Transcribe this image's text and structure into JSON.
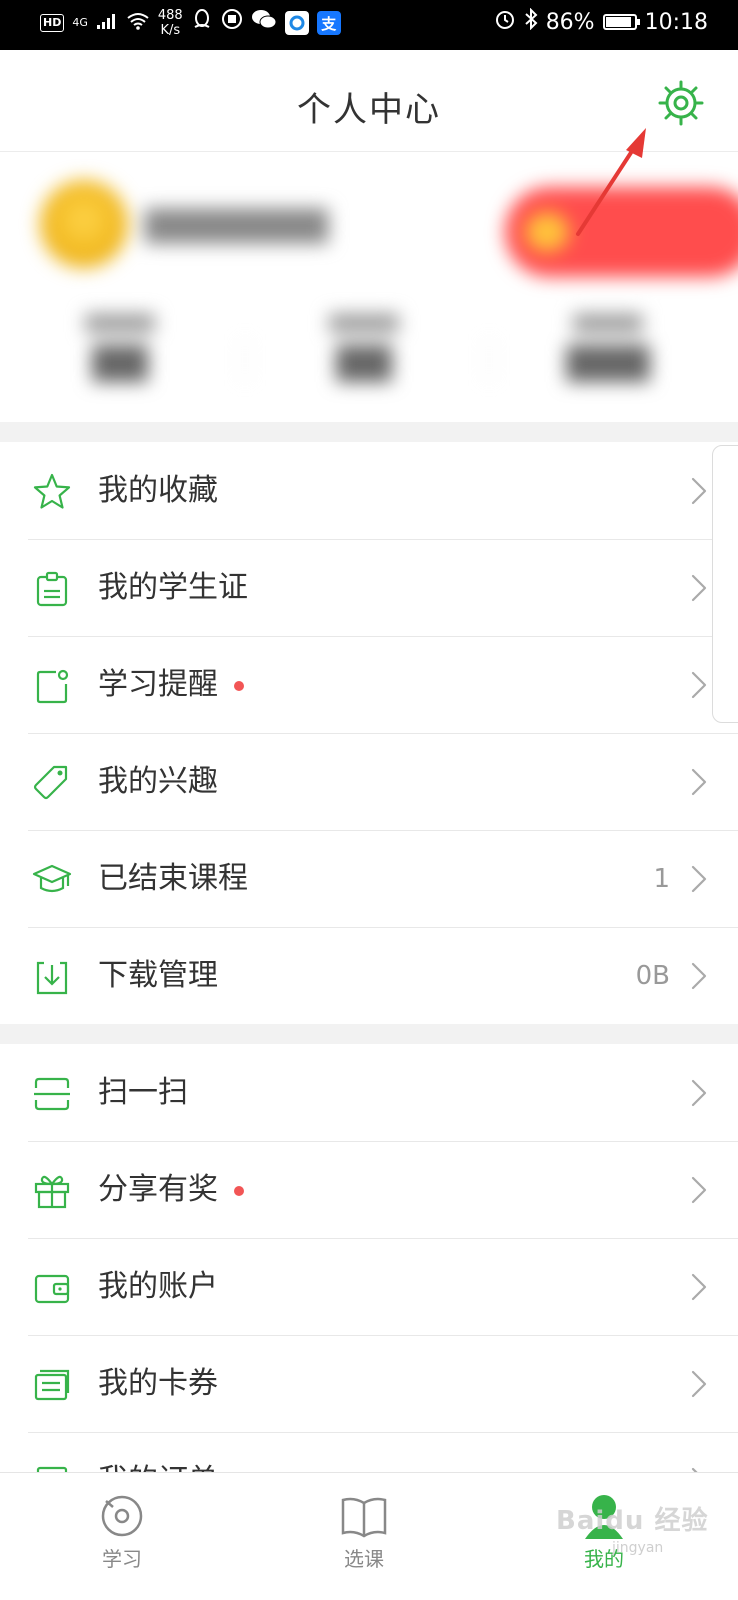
{
  "status_bar": {
    "hd": "HD",
    "network": "4G",
    "speed_value": "488",
    "speed_unit": "K/s",
    "app_icons": [
      "qq-icon",
      "vpn-icon",
      "wechat-icon",
      "browser-icon",
      "alipay-icon"
    ],
    "alipay_glyph": "支",
    "battery_percent": "86%",
    "battery_level": 0.86,
    "time": "10:18"
  },
  "header": {
    "title": "个人中心",
    "settings_icon": "gear-icon"
  },
  "colors": {
    "accent": "#37b34a",
    "dot": "#f25555",
    "annotation": "#e53935"
  },
  "menu_group_1": [
    {
      "label": "我的收藏",
      "icon": "star-icon",
      "dot": false,
      "value": ""
    },
    {
      "label": "我的学生证",
      "icon": "student-card-icon",
      "dot": false,
      "value": ""
    },
    {
      "label": "学习提醒",
      "icon": "reminder-icon",
      "dot": true,
      "value": ""
    },
    {
      "label": "我的兴趣",
      "icon": "tag-icon",
      "dot": false,
      "value": ""
    },
    {
      "label": "已结束课程",
      "icon": "graduation-cap-icon",
      "dot": false,
      "value": "1"
    },
    {
      "label": "下载管理",
      "icon": "download-icon",
      "dot": false,
      "value": "0B"
    }
  ],
  "menu_group_2": [
    {
      "label": "扫一扫",
      "icon": "scan-icon",
      "dot": false,
      "value": ""
    },
    {
      "label": "分享有奖",
      "icon": "gift-icon",
      "dot": true,
      "value": ""
    },
    {
      "label": "我的账户",
      "icon": "wallet-icon",
      "dot": false,
      "value": ""
    },
    {
      "label": "我的卡券",
      "icon": "coupon-icon",
      "dot": false,
      "value": ""
    },
    {
      "label": "我的订单",
      "icon": "order-icon",
      "dot": false,
      "value": ""
    }
  ],
  "tabbar": [
    {
      "label": "学习",
      "icon": "study-icon",
      "active": false
    },
    {
      "label": "选课",
      "icon": "book-icon",
      "active": false
    },
    {
      "label": "我的",
      "icon": "profile-icon",
      "active": true
    }
  ],
  "watermark": {
    "text": "Baidu 经验",
    "sub": "jingyan"
  }
}
